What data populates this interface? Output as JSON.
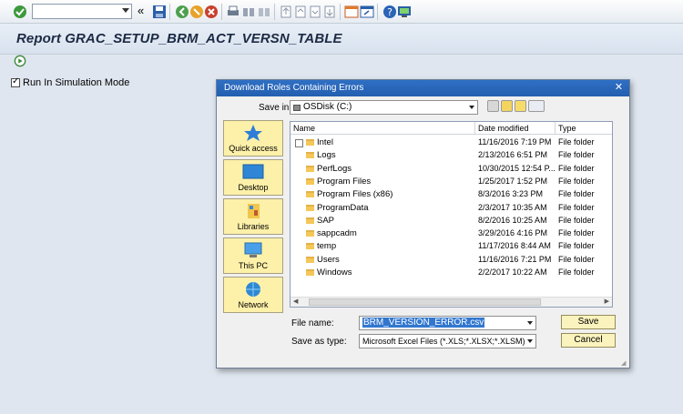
{
  "toolbar": {
    "command_field_value": ""
  },
  "report": {
    "title": "Report GRAC_SETUP_BRM_ACT_VERSN_TABLE"
  },
  "options": {
    "simulation_label": "Run In Simulation Mode",
    "simulation_checked": true
  },
  "dialog": {
    "title": "Download Roles Containing Errors",
    "close_symbol": "✕",
    "save_in_label": "Save in:",
    "save_in_value": "OSDisk (C:)",
    "places": [
      {
        "label": "Quick access"
      },
      {
        "label": "Desktop"
      },
      {
        "label": "Libraries"
      },
      {
        "label": "This PC"
      },
      {
        "label": "Network"
      }
    ],
    "columns": {
      "name": "Name",
      "date": "Date modified",
      "type": "Type"
    },
    "files": [
      {
        "name": "Intel",
        "date": "11/16/2016 7:19 PM",
        "type": "File folder"
      },
      {
        "name": "Logs",
        "date": "2/13/2016 6:51 PM",
        "type": "File folder"
      },
      {
        "name": "PerfLogs",
        "date": "10/30/2015 12:54 P...",
        "type": "File folder"
      },
      {
        "name": "Program Files",
        "date": "1/25/2017 1:52 PM",
        "type": "File folder"
      },
      {
        "name": "Program Files (x86)",
        "date": "8/3/2016 3:23 PM",
        "type": "File folder"
      },
      {
        "name": "ProgramData",
        "date": "2/3/2017 10:35 AM",
        "type": "File folder"
      },
      {
        "name": "SAP",
        "date": "8/2/2016 10:25 AM",
        "type": "File folder"
      },
      {
        "name": "sappcadm",
        "date": "3/29/2016 4:16 PM",
        "type": "File folder"
      },
      {
        "name": "temp",
        "date": "11/17/2016 8:44 AM",
        "type": "File folder"
      },
      {
        "name": "Users",
        "date": "11/16/2016 7:21 PM",
        "type": "File folder"
      },
      {
        "name": "Windows",
        "date": "2/2/2017 10:22 AM",
        "type": "File folder"
      }
    ],
    "file_name_label": "File name:",
    "file_name_value": "BRM_VERSION_ERROR.csv",
    "save_as_type_label": "Save as type:",
    "save_as_type_value": "Microsoft Excel Files (*.XLS;*.XLSX;*.XLSM)",
    "save_label": "Save",
    "cancel_label": "Cancel"
  }
}
